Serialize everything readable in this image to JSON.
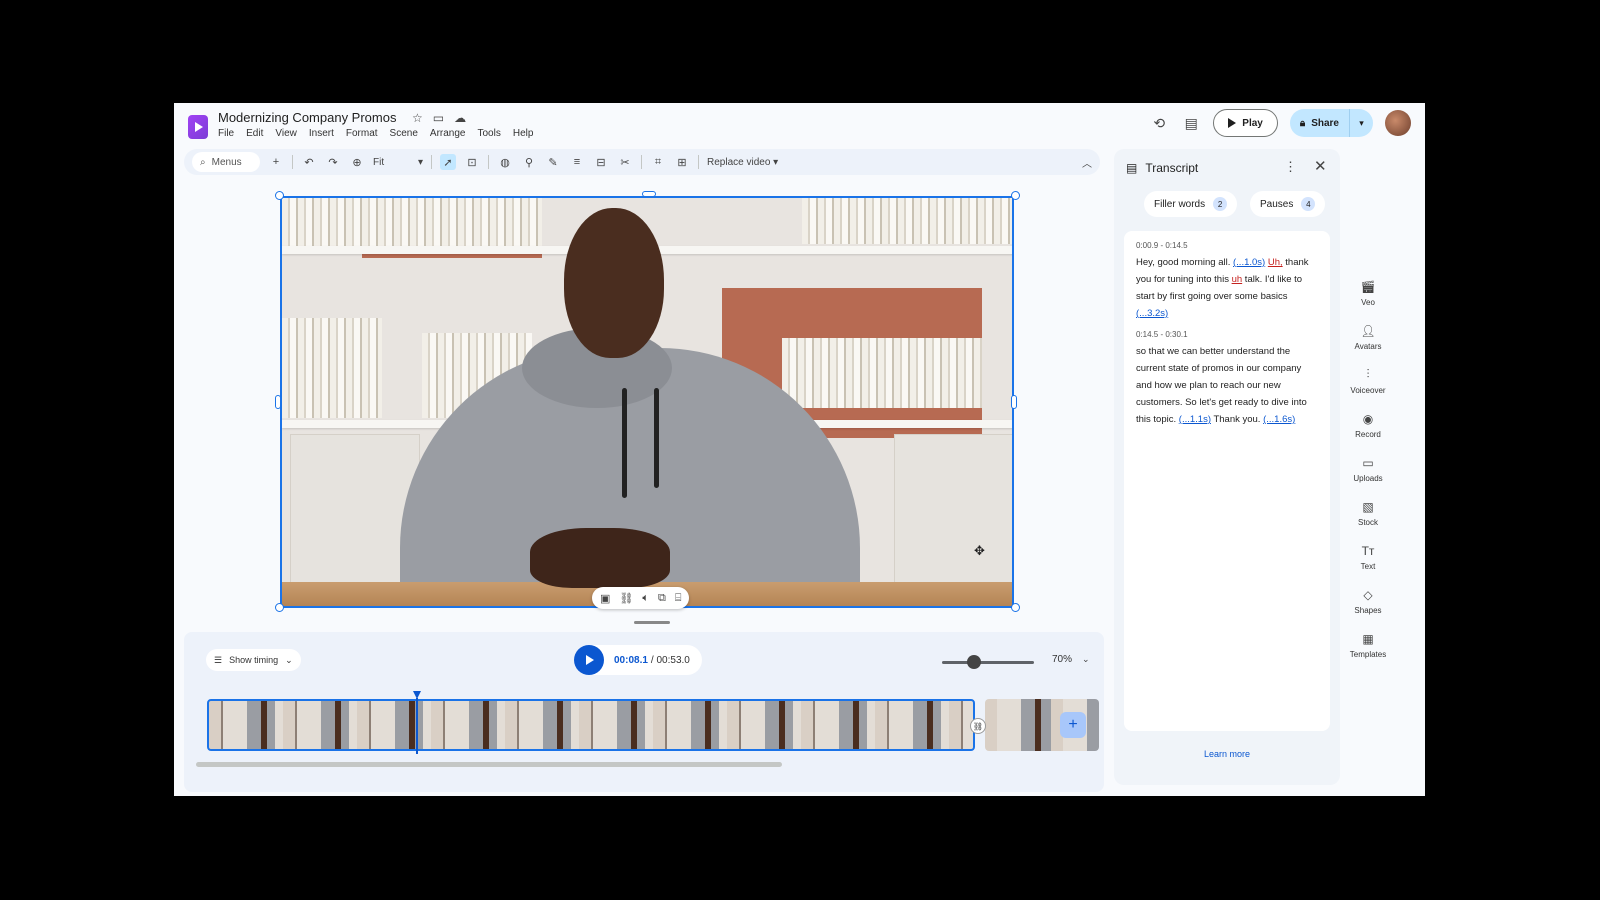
{
  "header": {
    "doc_title": "Modernizing Company Promos",
    "menu": [
      "File",
      "Edit",
      "View",
      "Insert",
      "Format",
      "Scene",
      "Arrange",
      "Tools",
      "Help"
    ],
    "play_label": "Play",
    "share_label": "Share"
  },
  "toolbar": {
    "search_placeholder": "Menus",
    "zoom_fit": "Fit",
    "replace_video": "Replace video"
  },
  "timeline": {
    "show_timing": "Show timing",
    "current_time": "00:08.1",
    "total_time": "/ 00:53.0",
    "zoom_percent": "70%"
  },
  "transcript": {
    "title": "Transcript",
    "chips": [
      {
        "label": "Filler words",
        "count": "2"
      },
      {
        "label": "Pauses",
        "count": "4"
      }
    ],
    "segments": [
      {
        "time": "0:00.9 - 0:14.5",
        "t1": "Hey, good morning all. ",
        "p1": "(...1.0s)",
        "f1": "Uh,",
        "t2": "thank you for tuning into this ",
        "f2": "uh",
        "t3": " talk. I'd like to start by first going over some basics ",
        "p2": "(...3.2s)"
      },
      {
        "time": "0:14.5 - 0:30.1",
        "t1": "so that we can better understand the current state of promos in our company and how we plan to reach our new customers. So let's get ready to dive into this topic. ",
        "p1": "(...1.1s)",
        "t2": " Thank you. ",
        "p2": "(...1.6s)"
      }
    ],
    "learn_more": "Learn more"
  },
  "rail": [
    "Veo",
    "Avatars",
    "Voiceover",
    "Record",
    "Uploads",
    "Stock",
    "Text",
    "Shapes",
    "Templates"
  ],
  "colors": {
    "accent": "#0b57d0",
    "selection": "#1a73e8",
    "share_bg": "#c2e7ff",
    "panel_bg": "#f0f4f9",
    "filler": "#c5221f"
  }
}
